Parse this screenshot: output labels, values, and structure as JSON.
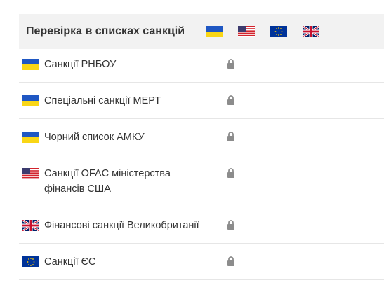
{
  "panel": {
    "title": "Перевірка в списках санкцій",
    "header_flags": [
      "ua-flag-icon",
      "us-flag-icon",
      "eu-flag-icon",
      "uk-flag-icon"
    ]
  },
  "rows": [
    {
      "label": "Санкції РНБОУ",
      "flag": "ua-flag-icon",
      "status": "lock-icon"
    },
    {
      "label": "Спеціальні санкції МЕРТ",
      "flag": "ua-flag-icon",
      "status": "lock-icon"
    },
    {
      "label": "Чорний список АМКУ",
      "flag": "ua-flag-icon",
      "status": "lock-icon"
    },
    {
      "label": "Санкції OFAC міністерства фінансів США",
      "flag": "us-flag-icon",
      "status": "lock-icon"
    },
    {
      "label": "Фінансові санкції Великобританії",
      "flag": "uk-flag-icon",
      "status": "lock-icon"
    },
    {
      "label": "Санкції ЄС",
      "flag": "eu-flag-icon",
      "status": "lock-icon"
    }
  ],
  "colors": {
    "ua_blue": "#1f57c3",
    "ua_yellow": "#f9d616",
    "us_red": "#d2232c",
    "us_blue": "#3c3b6e",
    "eu_blue": "#003399",
    "eu_gold": "#ffcc00",
    "uk_blue": "#012169",
    "uk_red": "#c8102e",
    "lock_gray": "#8c8c8c"
  }
}
